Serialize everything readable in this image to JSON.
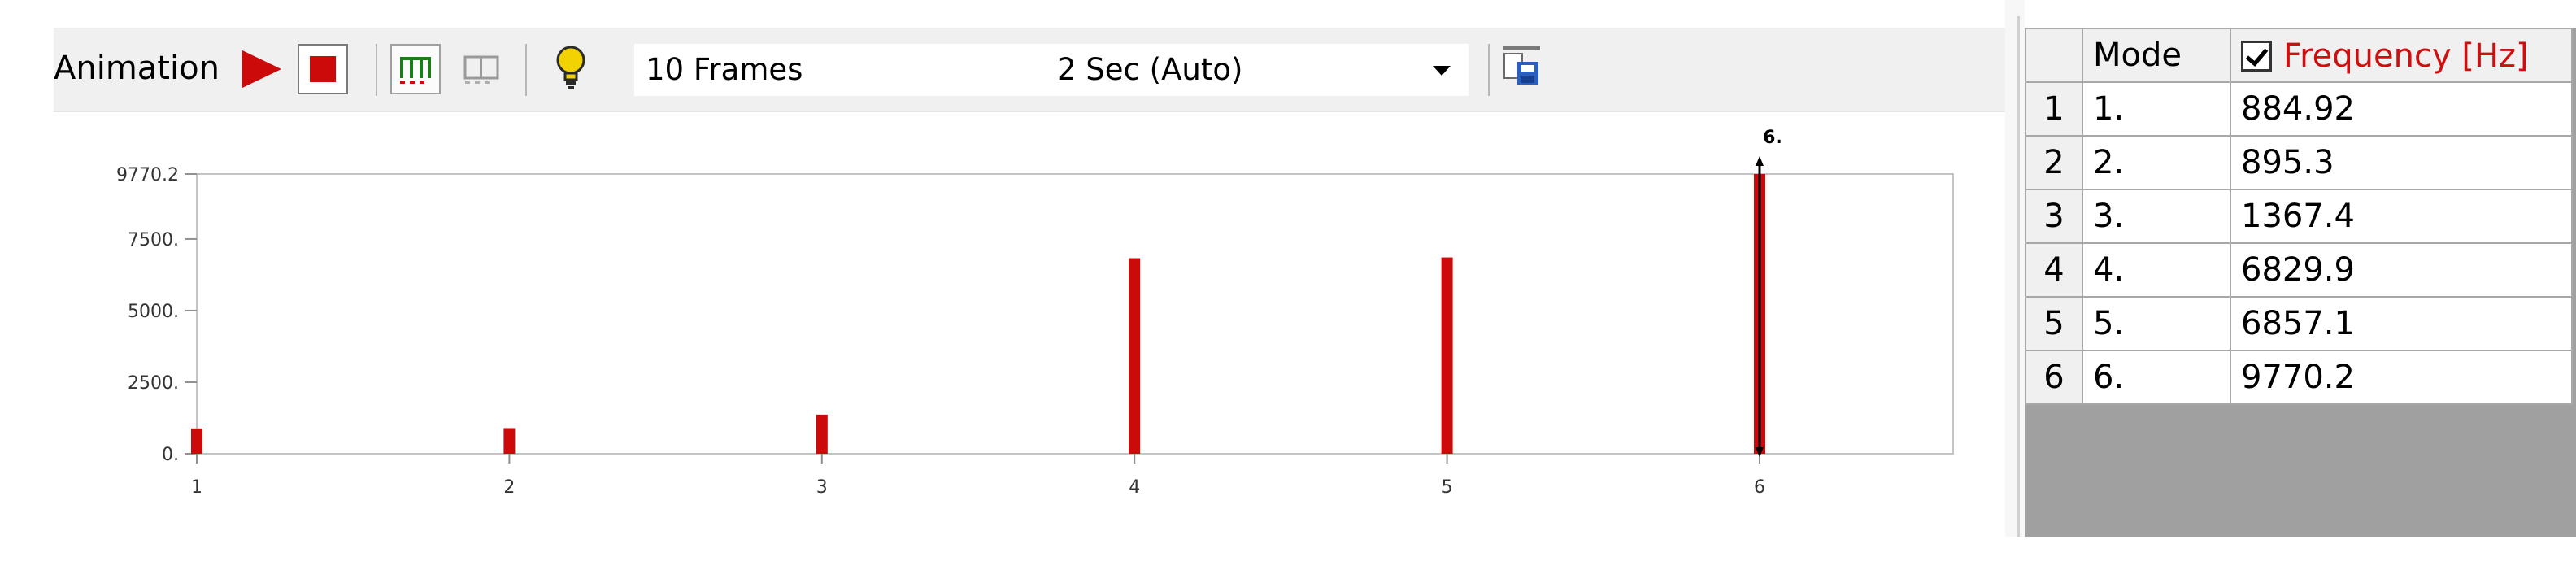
{
  "toolbar": {
    "animation_label": "Animation",
    "frames_select": "10 Frames",
    "duration_select": "2 Sec (Auto)",
    "icons": [
      "play-icon",
      "stop-icon",
      "distributed-frames-icon",
      "result-sets-icon",
      "lightbulb-icon",
      "export-video-icon"
    ]
  },
  "colors": {
    "bar": "#cc0a0a",
    "frequency_header": "#cc1010",
    "grid_fill": "#a0a0a0"
  },
  "chart_data": {
    "type": "bar",
    "categories": [
      "1",
      "2",
      "3",
      "4",
      "5",
      "6"
    ],
    "values": [
      884.92,
      895.3,
      1367.4,
      6829.9,
      6857.1,
      9770.2
    ],
    "ylim": [
      0,
      9770.2
    ],
    "ytick_labels": [
      "9770.2",
      "7500.",
      "5000.",
      "2500.",
      "0."
    ],
    "ytick_values": [
      9770.2,
      7500,
      5000,
      2500,
      0
    ],
    "selected_marker": {
      "category": "6",
      "label": "6."
    }
  },
  "table": {
    "headers": {
      "row": "",
      "mode": "Mode",
      "frequency": "Frequency [Hz]"
    },
    "frequency_checked": true,
    "rows": [
      {
        "row": "1",
        "mode": "1.",
        "frequency": "884.92"
      },
      {
        "row": "2",
        "mode": "2.",
        "frequency": "895.3"
      },
      {
        "row": "3",
        "mode": "3.",
        "frequency": "1367.4"
      },
      {
        "row": "4",
        "mode": "4.",
        "frequency": "6829.9"
      },
      {
        "row": "5",
        "mode": "5.",
        "frequency": "6857.1"
      },
      {
        "row": "6",
        "mode": "6.",
        "frequency": "9770.2"
      }
    ]
  }
}
